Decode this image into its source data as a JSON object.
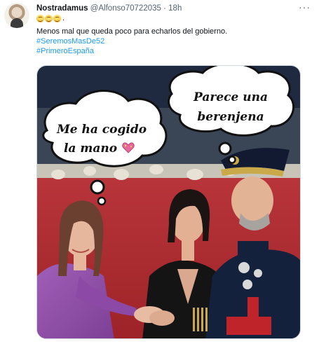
{
  "tweet": {
    "display_name": "Nostradamus",
    "handle": "@Alfonso70722035",
    "separator": "·",
    "time": "18h",
    "more_icon": "ellipsis-icon",
    "emoji_icons": [
      "grinning-face-icon",
      "grinning-face-icon",
      "grinning-face-icon"
    ],
    "emoji_tail": ".",
    "text_line": "Menos mal que queda poco para echarlos del gobierno.",
    "hashtags": [
      "#SeremosMasDe52",
      "#PrimeroEspaña"
    ]
  },
  "meme": {
    "bubble_left": [
      "Me ha cogido",
      "la mano"
    ],
    "bubble_left_icon": "sparkling-heart-icon",
    "bubble_right": [
      "Parece una",
      "berenjena"
    ]
  }
}
